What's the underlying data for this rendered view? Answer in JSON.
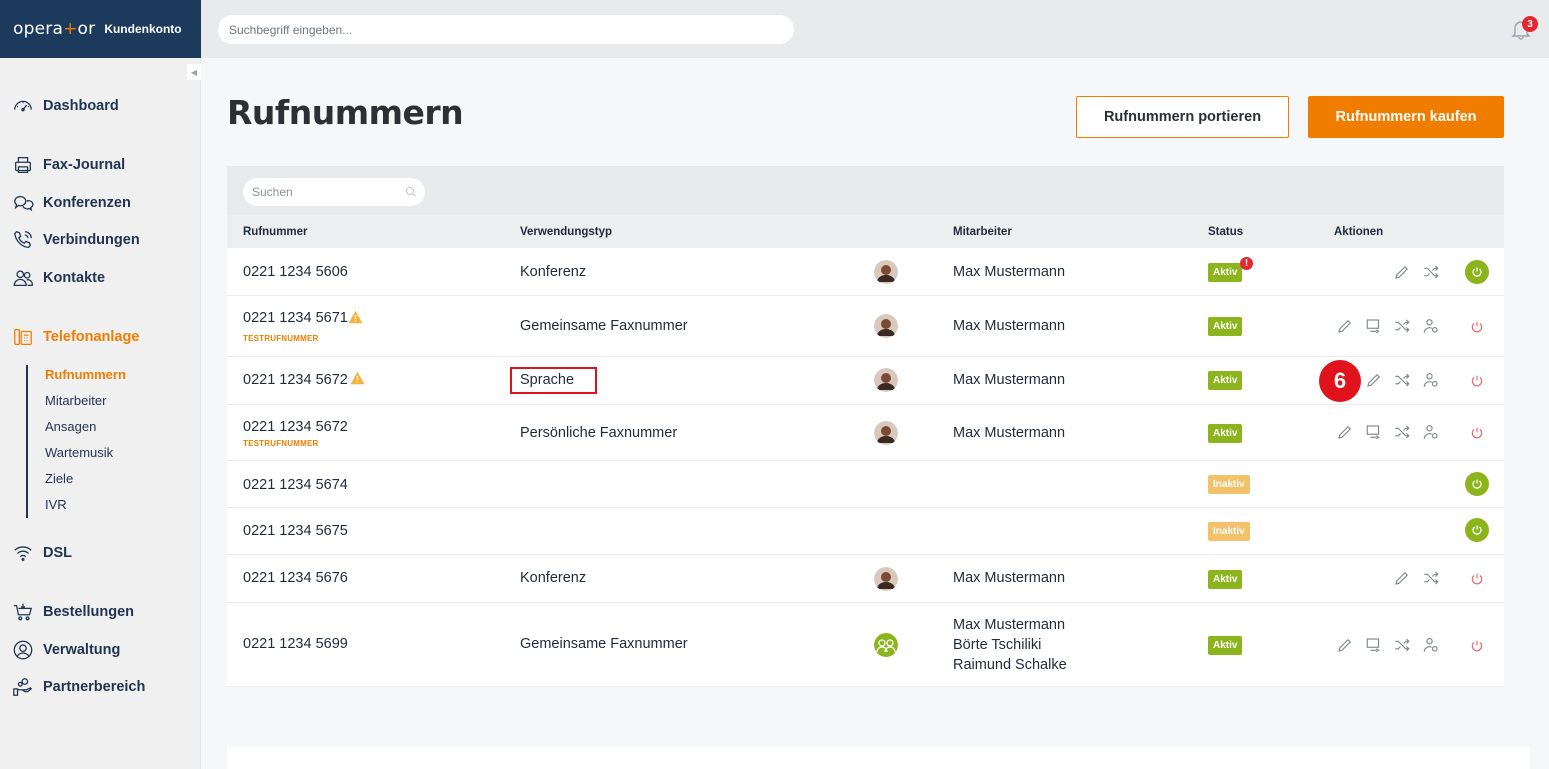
{
  "brand": {
    "logo_left": "opera",
    "logo_plus": "+",
    "logo_right": "or",
    "account": "Kundenkonto"
  },
  "topbar": {
    "search_placeholder": "Suchbegriff eingeben...",
    "notification_count": "3"
  },
  "sidebar": {
    "items": [
      {
        "label": "Dashboard",
        "icon": "speedometer-icon"
      },
      {
        "label": "Fax-Journal",
        "icon": "fax-icon"
      },
      {
        "label": "Konferenzen",
        "icon": "chat-bubbles-icon"
      },
      {
        "label": "Verbindungen",
        "icon": "phone-icon"
      },
      {
        "label": "Kontakte",
        "icon": "contacts-icon"
      },
      {
        "label": "Telefonanlage",
        "icon": "pbx-icon",
        "active": true
      },
      {
        "label": "DSL",
        "icon": "wifi-icon"
      },
      {
        "label": "Bestellungen",
        "icon": "cart-icon"
      },
      {
        "label": "Verwaltung",
        "icon": "user-circle-icon"
      },
      {
        "label": "Partnerbereich",
        "icon": "hand-icon"
      }
    ],
    "sub_items": [
      "Rufnummern",
      "Mitarbeiter",
      "Ansagen",
      "Wartemusik",
      "Ziele",
      "IVR"
    ]
  },
  "page": {
    "title": "Rufnummern",
    "port_button": "Rufnummern portieren",
    "buy_button": "Rufnummern kaufen"
  },
  "table": {
    "search_placeholder": "Suchen",
    "columns": {
      "number": "Rufnummer",
      "usage": "Verwendungstyp",
      "employee": "Mitarbeiter",
      "status": "Status",
      "actions": "Aktionen"
    },
    "rows": [
      {
        "number": "0221 1234 5606",
        "usage": "Konferenz",
        "employee": "Max Mustermann",
        "status": "Aktiv"
      },
      {
        "number": "0221 1234 5671",
        "test": "TESTRUFNUMMER",
        "usage": "Gemeinsame Faxnummer",
        "employee": "Max Mustermann",
        "status": "Aktiv"
      },
      {
        "number": "0221 1234 5672",
        "usage": "Sprache",
        "employee": "Max Mustermann",
        "status": "Aktiv"
      },
      {
        "number": "0221 1234 5672",
        "test": "TESTRUFNUMMER",
        "usage": "Persönliche Faxnummer",
        "employee": "Max Mustermann",
        "status": "Aktiv"
      },
      {
        "number": "0221 1234 5674",
        "status": "Inaktiv"
      },
      {
        "number": "0221 1234 5675",
        "status": "Inaktiv"
      },
      {
        "number": "0221 1234 5676",
        "usage": "Konferenz",
        "employee": "Max Mustermann",
        "status": "Aktiv"
      },
      {
        "number": "0221 1234 5699",
        "usage": "Gemeinsame Faxnummer",
        "employees": [
          "Max Mustermann",
          "Börte Tschiliki",
          "Raimund Schalke"
        ],
        "status": "Aktiv"
      }
    ]
  },
  "annotation": {
    "step": "6",
    "alert_mark": "!"
  },
  "colors": {
    "accent": "#f07d00",
    "navy": "#1b3a5c",
    "active_green": "#8cb51d",
    "inactive_yellow": "#f2c16a",
    "alert_red": "#e0121c"
  }
}
